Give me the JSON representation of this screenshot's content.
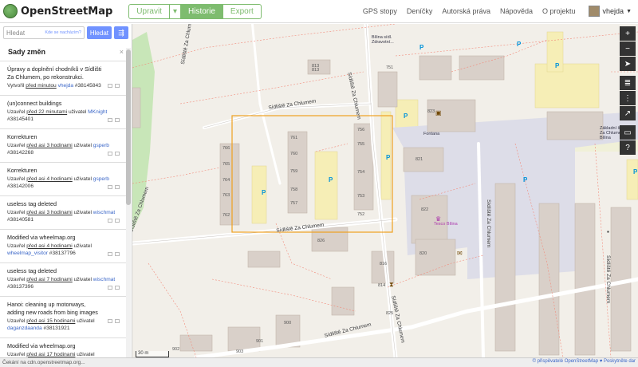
{
  "header": {
    "logo_text": "OpenStreetMap",
    "edit_label": "Upravit",
    "edit_caret": "▾",
    "history_label": "Historie",
    "export_label": "Export",
    "nav": [
      "GPS stopy",
      "Deníčky",
      "Autorská práva",
      "Nápověda",
      "O projektu"
    ],
    "user": "vhejda"
  },
  "search": {
    "placeholder": "Hledat",
    "hint": "Kde se nacházím?",
    "button": "Hledat"
  },
  "changesets": {
    "title": "Sady změn",
    "close": "×",
    "items": [
      {
        "desc": "Úpravy a doplnění chodníků v Sídlišti Za Chlumem, po rekonstrukci.",
        "meta_pre": "Vytvořil ",
        "time": "před minutou",
        "meta_mid": " ",
        "user": "vhejda",
        "id": "#38145843"
      },
      {
        "desc": "(un)connect buildings",
        "meta_pre": "Uzavřel ",
        "time": "před 22 minutami",
        "meta_mid": " uživatel ",
        "user": "MKnight",
        "id": "#38145401"
      },
      {
        "desc": "Korrekturen",
        "meta_pre": "Uzavřel ",
        "time": "před asi 3 hodinami",
        "meta_mid": " uživatel ",
        "user": "gsperb",
        "id": "#38142268"
      },
      {
        "desc": "Korrekturen",
        "meta_pre": "Uzavřel ",
        "time": "před asi 4 hodinami",
        "meta_mid": " uživatel ",
        "user": "gsperb",
        "id": "#38142006"
      },
      {
        "desc": "useless tag deleted",
        "meta_pre": "Uzavřel ",
        "time": "před asi 3 hodinami",
        "meta_mid": " uživatel ",
        "user": "wischmat",
        "id": "#38140581"
      },
      {
        "desc": "Modified via wheelmap.org",
        "meta_pre": "Uzavřel ",
        "time": "před asi 4 hodinami",
        "meta_mid": " uživatel ",
        "user": "wheelmap_visitor",
        "id": "#38137796"
      },
      {
        "desc": "useless tag deleted",
        "meta_pre": "Uzavřel ",
        "time": "před asi 7 hodinami",
        "meta_mid": " uživatel ",
        "user": "wischmat",
        "id": "#38137396"
      },
      {
        "desc": "Hanoi: cleaning up motorways, adding new roads from bing images",
        "meta_pre": "Uzavřel ",
        "time": "před asi 15 hodinami",
        "meta_mid": " uživatel ",
        "user": "daganzdaanda",
        "id": "#38131921"
      },
      {
        "desc": "Modified via wheelmap.org",
        "meta_pre": "Uzavřel ",
        "time": "před asi 17 hodinami",
        "meta_mid": " uživatel ",
        "user": "",
        "id": ""
      }
    ]
  },
  "map": {
    "streets": [
      "Sídliště Za Chlumem",
      "Sídliště Za Chlumem",
      "Sídliště Za Chlumem",
      "Sídliště Za Chlumem",
      "Sídliště Za Chlumem",
      "Sídliště Za Chlumem",
      "Sídliště Za Chlumem",
      "Sídliště Za Chlumem",
      "Sídliště Za Chlumem"
    ],
    "pois": {
      "bus": "Bílina sídl.",
      "bus2": "Zdravotní...",
      "fontana": "Fontana",
      "school": "Základní škola Za Chlumem Bílina",
      "tesco": "Tesco Bílina"
    },
    "house_numbers": [
      "813",
      "751",
      "823",
      "756",
      "755",
      "754",
      "753",
      "752",
      "761",
      "760",
      "759",
      "758",
      "757",
      "766",
      "765",
      "764",
      "763",
      "762",
      "821",
      "822",
      "820",
      "826",
      "816",
      "814",
      "825",
      "901",
      "902",
      "903",
      "813",
      "900"
    ],
    "parking": "P",
    "scale": "30 m"
  },
  "status": "Čekání na cdn.openstreetmap.org...",
  "attribution": "© přispěvatelé OpenStreetMap ♥ Poskytněte dar",
  "colors": {
    "accent": "#7ebc6f",
    "search": "#7092ff",
    "bbox": "#f0a020"
  }
}
